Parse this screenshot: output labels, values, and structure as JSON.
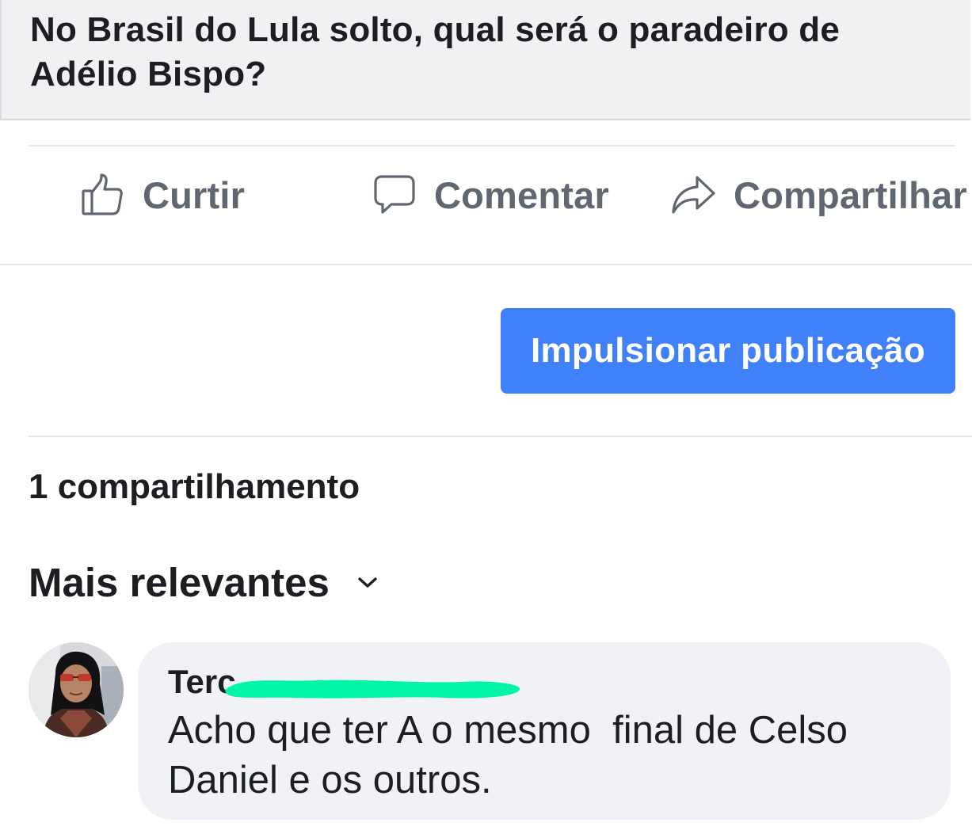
{
  "post": {
    "text": "No Brasil do Lula solto, qual será o paradeiro de Adélio Bispo?"
  },
  "actions": {
    "like_label": "Curtir",
    "comment_label": "Comentar",
    "share_label": "Compartilhar"
  },
  "boost": {
    "label": "Impulsionar publicação",
    "color": "#4080f9"
  },
  "shares": {
    "count_text": "1 compartilhamento"
  },
  "comments_sort": {
    "label": "Mais relevantes"
  },
  "comments": [
    {
      "author_visible": "Terc",
      "author_redacted": true,
      "redaction_color": "#00f5a8",
      "text": "Acho que ter A o mesmo  final de Celso Daniel e os outros."
    }
  ],
  "icons": {
    "like": "thumbs-up-icon",
    "comment": "speech-bubble-icon",
    "share": "share-arrow-icon",
    "sort": "chevron-down-icon"
  }
}
